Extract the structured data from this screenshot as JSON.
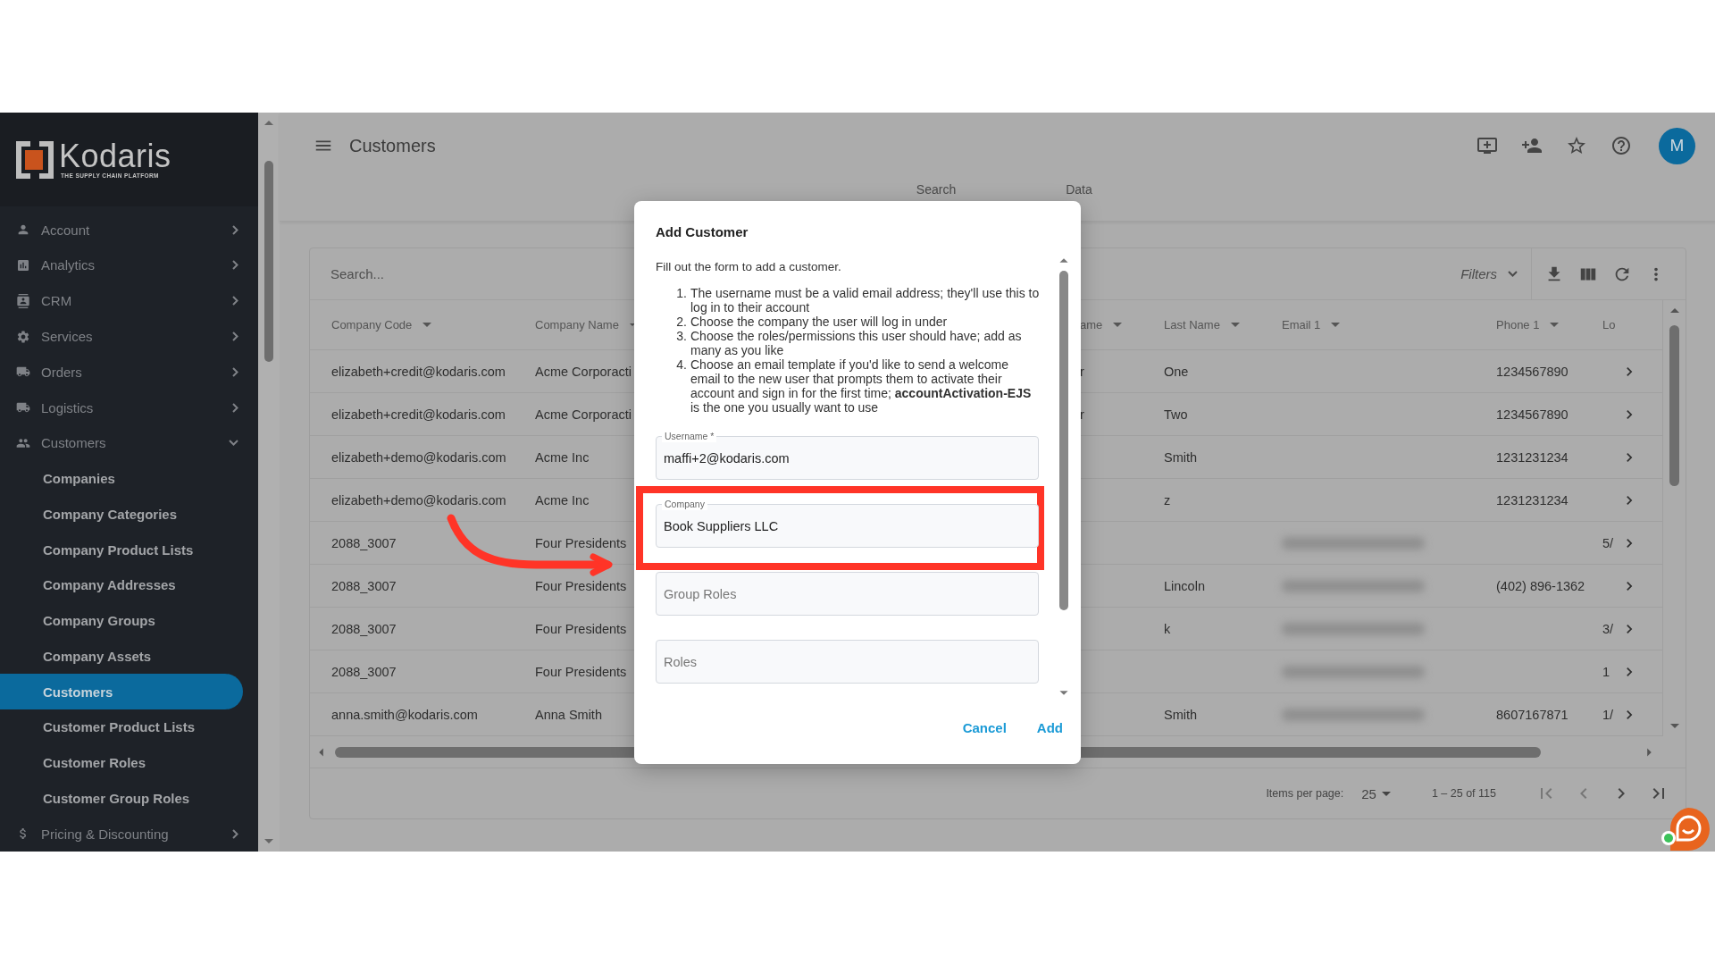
{
  "sidebar": {
    "logo": {
      "name": "Kodaris",
      "tagline": "THE SUPPLY CHAIN PLATFORM"
    },
    "items": [
      {
        "label": "Account",
        "expanded": false
      },
      {
        "label": "Analytics",
        "expanded": false
      },
      {
        "label": "CRM",
        "expanded": false
      },
      {
        "label": "Services",
        "expanded": false
      },
      {
        "label": "Orders",
        "expanded": false
      },
      {
        "label": "Logistics",
        "expanded": false
      },
      {
        "label": "Customers",
        "expanded": true,
        "children": [
          {
            "label": "Companies",
            "selected": false
          },
          {
            "label": "Company Categories",
            "selected": false
          },
          {
            "label": "Company Product Lists",
            "selected": false
          },
          {
            "label": "Company Addresses",
            "selected": false
          },
          {
            "label": "Company Groups",
            "selected": false
          },
          {
            "label": "Company Assets",
            "selected": false
          },
          {
            "label": "Customers",
            "selected": true
          },
          {
            "label": "Customer Product Lists",
            "selected": false
          },
          {
            "label": "Customer Roles",
            "selected": false
          },
          {
            "label": "Customer Group Roles",
            "selected": false
          }
        ]
      },
      {
        "label": "Pricing & Discounting",
        "expanded": false
      }
    ]
  },
  "header": {
    "title": "Customers",
    "avatar": "M"
  },
  "tabs": [
    {
      "label": "Search"
    },
    {
      "label": "Data"
    }
  ],
  "table": {
    "search_placeholder": "Search...",
    "filters": "Filters",
    "columns": [
      {
        "label": "Company Code",
        "sortable": true
      },
      {
        "label": "Company Name",
        "sortable": true
      },
      {
        "label": "ame",
        "sortable": true
      },
      {
        "label": "Last Name",
        "sortable": true
      },
      {
        "label": "Email 1",
        "sortable": true
      },
      {
        "label": "Phone 1",
        "sortable": true
      },
      {
        "label": "Lo"
      }
    ],
    "rows": [
      {
        "company_code": "elizabeth+credit@kodaris.com",
        "company_name": "Acme Corporacti",
        "column_3": "r",
        "last_name": "One",
        "phone_1": "1234567890"
      },
      {
        "company_code": "elizabeth+credit@kodaris.com",
        "company_name": "Acme Corporacti",
        "column_3": "r",
        "last_name": "Two",
        "phone_1": "1234567890"
      },
      {
        "company_code": "elizabeth+demo@kodaris.com",
        "company_name": "Acme Inc",
        "last_name": "Smith",
        "phone_1": "1231231234"
      },
      {
        "company_code": "elizabeth+demo@kodaris.com",
        "company_name": "Acme Inc",
        "last_name": "z",
        "phone_1": "1231231234"
      },
      {
        "company_code": "2088_3007",
        "company_name": "Four Presidents",
        "email_blurred": true,
        "column_7": "5/"
      },
      {
        "company_code": "2088_3007",
        "company_name": "Four Presidents",
        "last_name": "Lincoln",
        "email_blurred": true,
        "phone_1": "(402) 896-1362"
      },
      {
        "company_code": "2088_3007",
        "company_name": "Four Presidents",
        "last_name": "k",
        "email_blurred": true,
        "column_7": "3/"
      },
      {
        "company_code": "2088_3007",
        "company_name": "Four Presidents",
        "email_blurred": true,
        "column_7": "1"
      },
      {
        "company_code": "anna.smith@kodaris.com",
        "company_name": "Anna Smith",
        "last_name": "Smith",
        "email_blurred": true,
        "phone_1": "8607167871",
        "column_7": "1/"
      }
    ],
    "pagination": {
      "label": "Items per page:",
      "page_size": "25",
      "range": "1 – 25 of 115"
    }
  },
  "dialog": {
    "title": "Add Customer",
    "intro": "Fill out the form to add a customer.",
    "steps": [
      {
        "number": "1.",
        "text": "The username must be a valid email address; they'll use this to log in to their account"
      },
      {
        "number": "2.",
        "text": "Choose the company the user will log in under"
      },
      {
        "number": "3.",
        "text": "Choose the roles/permissions this user should have; add as many as you like"
      },
      {
        "number": "4.",
        "text": "Choose an email template if you'd like to send a welcome email to the new user that prompts them to activate their account and sign in for the first time; **accountActivation-EJS** is the one you usually want to use"
      }
    ],
    "fields": [
      {
        "label": "Username *",
        "value": "maffi+2@kodaris.com",
        "highlighted": false
      },
      {
        "label": "Company",
        "value": "Book Suppliers LLC",
        "highlighted": true
      },
      {
        "placeholder": "Group Roles",
        "highlighted": false
      },
      {
        "placeholder": "Roles",
        "highlighted": false
      }
    ],
    "buttons": [
      "Cancel",
      "Add"
    ]
  }
}
